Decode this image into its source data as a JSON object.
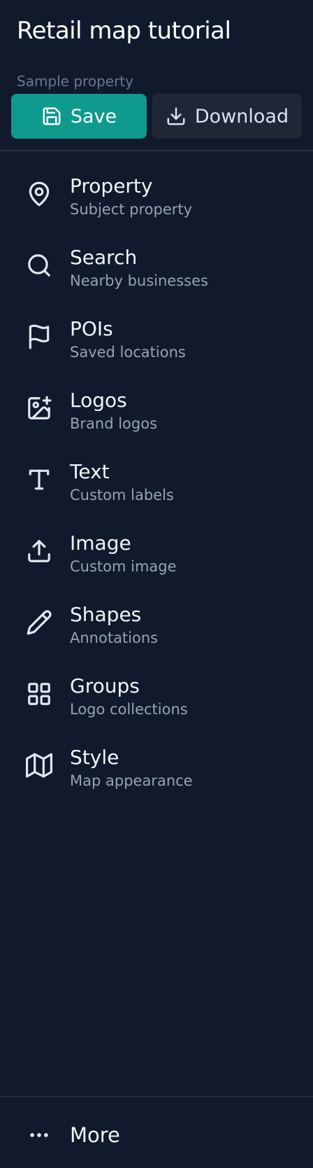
{
  "header": {
    "title": "Retail map tutorial",
    "subtitle": "Sample property",
    "save_label": "Save",
    "download_label": "Download"
  },
  "colors": {
    "background": "#111a2c",
    "save_button": "#0e9a8c",
    "download_button": "#1f2737",
    "muted_text": "#94a3b8"
  },
  "nav": {
    "items": [
      {
        "icon": "map-pin-icon",
        "label": "Property",
        "desc": "Subject property"
      },
      {
        "icon": "search-icon",
        "label": "Search",
        "desc": "Nearby businesses"
      },
      {
        "icon": "flag-icon",
        "label": "POIs",
        "desc": "Saved locations"
      },
      {
        "icon": "image-plus-icon",
        "label": "Logos",
        "desc": "Brand logos"
      },
      {
        "icon": "type-icon",
        "label": "Text",
        "desc": "Custom labels"
      },
      {
        "icon": "upload-icon",
        "label": "Image",
        "desc": "Custom image"
      },
      {
        "icon": "pencil-icon",
        "label": "Shapes",
        "desc": "Annotations"
      },
      {
        "icon": "grid-icon",
        "label": "Groups",
        "desc": "Logo collections"
      },
      {
        "icon": "map-icon",
        "label": "Style",
        "desc": "Map appearance"
      }
    ]
  },
  "footer": {
    "more_label": "More",
    "more_icon": "more-horizontal-icon"
  }
}
